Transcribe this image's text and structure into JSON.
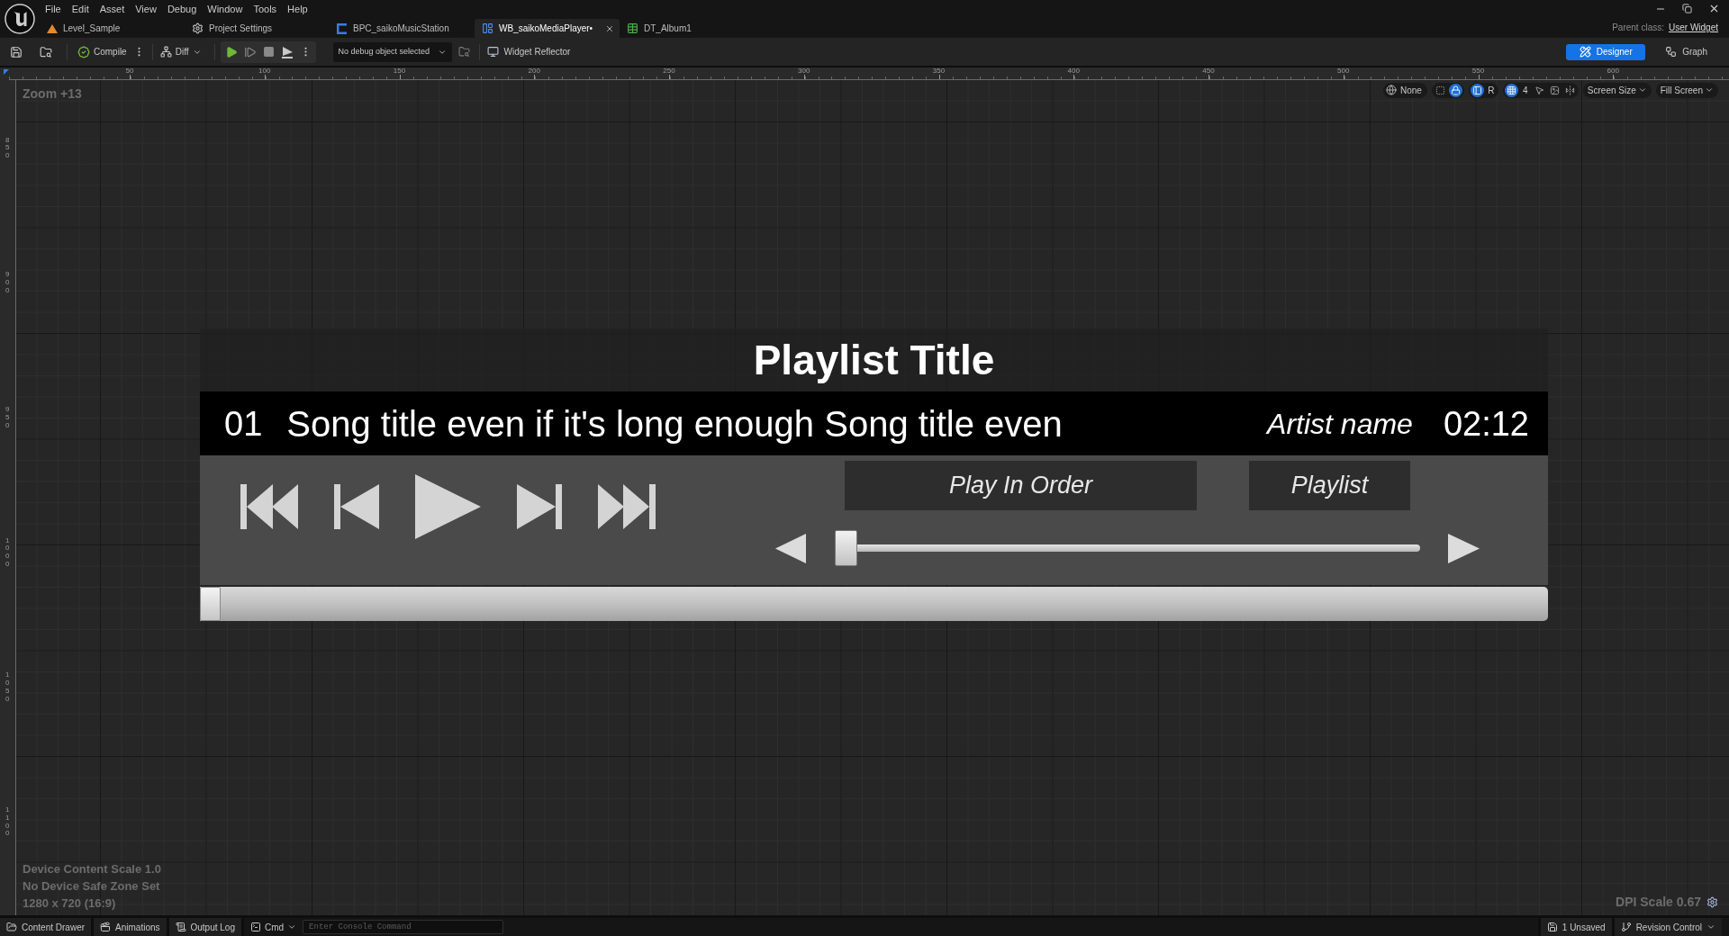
{
  "menu_bar": {
    "items": [
      "File",
      "Edit",
      "Asset",
      "View",
      "Debug",
      "Window",
      "Tools",
      "Help"
    ]
  },
  "tabs": [
    {
      "label": "Level_Sample",
      "kind": "level",
      "selected": false
    },
    {
      "label": "Project Settings",
      "kind": "settings",
      "selected": false
    },
    {
      "label": "BPC_saikoMusicStation",
      "kind": "class",
      "selected": false
    },
    {
      "label": "WB_saikoMediaPlayer•",
      "kind": "widget",
      "selected": true
    },
    {
      "label": "DT_Album1",
      "kind": "table",
      "selected": false
    }
  ],
  "parent_class": {
    "label": "Parent class:",
    "value": "User Widget"
  },
  "toolbar": {
    "compile": "Compile",
    "diff": "Diff",
    "debug_object": "No debug object selected",
    "widget_reflector": "Widget Reflector"
  },
  "modes": [
    {
      "label": "Designer",
      "kind": "designer",
      "selected": true
    },
    {
      "label": "Graph",
      "kind": "graph",
      "selected": false
    }
  ],
  "ruler": {
    "horizontal": [
      "50",
      "100",
      "150",
      "200",
      "250",
      "300",
      "350",
      "400",
      "450",
      "500",
      "550",
      "600"
    ],
    "vertical": [
      "850",
      "900",
      "950",
      "1000",
      "1050",
      "1100"
    ]
  },
  "viewport_toolbar": {
    "localization": "None",
    "groups": [
      {
        "items": [
          {
            "kind": "marquee",
            "on": false
          },
          {
            "kind": "lock",
            "on": true
          }
        ]
      },
      {
        "items": [
          {
            "kind": "layout",
            "on": true
          },
          {
            "kind": "letter",
            "label": "R",
            "on": false
          }
        ]
      },
      {
        "items": [
          {
            "kind": "grid",
            "on": true
          },
          {
            "kind": "letter",
            "label": "4",
            "on": false
          },
          {
            "kind": "pointer",
            "on": false
          },
          {
            "kind": "image",
            "on": false
          },
          {
            "kind": "mirror",
            "on": false
          }
        ]
      }
    ],
    "dropdowns": [
      "Screen Size",
      "Fill Screen"
    ]
  },
  "canvas": {
    "zoom": "Zoom +13",
    "device_info": [
      "Device Content Scale 1.0",
      "No Device Safe Zone Set",
      "1280 x 720 (16:9)"
    ],
    "dpi_scale": "DPI Scale 0.67"
  },
  "media_player": {
    "playlist_title": "Playlist Title",
    "now_playing": {
      "track_number": "01",
      "title": "Song title even if it's long enough Song title even",
      "artist": "Artist name",
      "duration": "02:12"
    },
    "transport": [
      {
        "kind": "first"
      },
      {
        "kind": "previous"
      },
      {
        "kind": "play"
      },
      {
        "kind": "next"
      },
      {
        "kind": "last"
      }
    ],
    "order_button": "Play In Order",
    "playlist_button": "Playlist",
    "volume": {
      "level": 0
    },
    "progress": {
      "level": 0
    }
  },
  "status_bar": {
    "items": [
      {
        "kind": "drawer",
        "label": "Content Drawer"
      },
      {
        "kind": "animations",
        "label": "Animations"
      },
      {
        "kind": "log",
        "label": "Output Log"
      }
    ],
    "console": {
      "mode": "Cmd",
      "placeholder": "Enter Console Command"
    },
    "right_items": [
      {
        "kind": "unsaved",
        "label": "1 Unsaved"
      },
      {
        "kind": "revision",
        "label": "Revision Control"
      }
    ]
  }
}
